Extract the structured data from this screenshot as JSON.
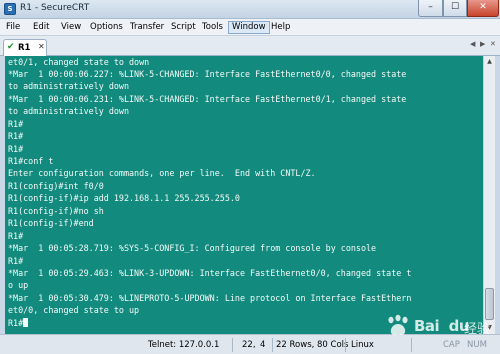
{
  "window": {
    "title": "R1 - SecureCRT",
    "min_label": "–",
    "max_label": "☐",
    "close_label": "✕"
  },
  "menu": [
    "File",
    "Edit",
    "View",
    "Options",
    "Transfer",
    "Script",
    "Tools",
    "Window",
    "Help"
  ],
  "active_menu": "Window",
  "tab": {
    "check": "✔",
    "label": "R1",
    "close": "✕"
  },
  "tab_nav": {
    "left": "◀",
    "right": "▶",
    "close": "✕"
  },
  "terminal": {
    "background": "#128a7d",
    "lines": [
      "et0/1, changed state to down",
      "*Mar  1 00:00:06.227: %LINK-5-CHANGED: Interface FastEthernet0/0, changed state",
      "to administratively down",
      "*Mar  1 00:00:06.231: %LINK-5-CHANGED: Interface FastEthernet0/1, changed state",
      "to administratively down",
      "R1#",
      "R1#",
      "R1#",
      "R1#conf t",
      "Enter configuration commands, one per line.  End with CNTL/Z.",
      "R1(config)#int f0/0",
      "R1(config-if)#ip add 192.168.1.1 255.255.255.0",
      "R1(config-if)#no sh",
      "R1(config-if)#end",
      "R1#",
      "*Mar  1 00:05:28.719: %SYS-5-CONFIG_I: Configured from console by console",
      "R1#",
      "*Mar  1 00:05:29.463: %LINK-3-UPDOWN: Interface FastEthernet0/0, changed state t",
      "o up",
      "*Mar  1 00:05:30.479: %LINEPROTO-5-UPDOWN: Line protocol on Interface FastEthern",
      "et0/0, changed state to up",
      "R1#"
    ]
  },
  "scrollbar": {
    "up": "▲",
    "down": "▼"
  },
  "status": {
    "connection": "Telnet: 127.0.0.1",
    "row": "22,",
    "col": "4",
    "size": "22 Rows, 80 Cols",
    "os": "Linux",
    "caps": "CAP",
    "num": "NUM"
  },
  "watermark": {
    "text": "Bai  du",
    "sub": "经验"
  }
}
